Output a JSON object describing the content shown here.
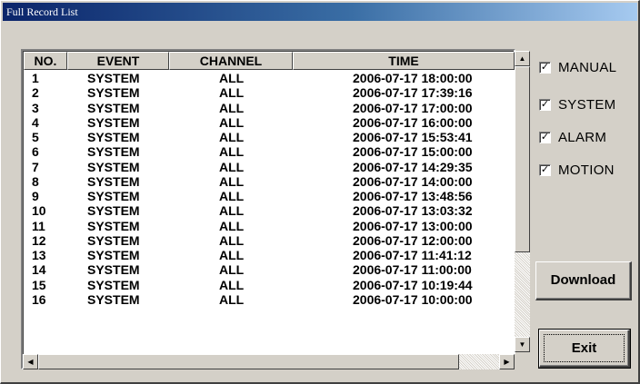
{
  "window": {
    "title": "Full Record List"
  },
  "table": {
    "columns": [
      "NO.",
      "EVENT",
      "CHANNEL",
      "TIME"
    ],
    "rows": [
      {
        "no": "1",
        "event": "SYSTEM",
        "channel": "ALL",
        "time": "2006-07-17  18:00:00"
      },
      {
        "no": "2",
        "event": "SYSTEM",
        "channel": "ALL",
        "time": "2006-07-17  17:39:16"
      },
      {
        "no": "3",
        "event": "SYSTEM",
        "channel": "ALL",
        "time": "2006-07-17  17:00:00"
      },
      {
        "no": "4",
        "event": "SYSTEM",
        "channel": "ALL",
        "time": "2006-07-17  16:00:00"
      },
      {
        "no": "5",
        "event": "SYSTEM",
        "channel": "ALL",
        "time": "2006-07-17  15:53:41"
      },
      {
        "no": "6",
        "event": "SYSTEM",
        "channel": "ALL",
        "time": "2006-07-17  15:00:00"
      },
      {
        "no": "7",
        "event": "SYSTEM",
        "channel": "ALL",
        "time": "2006-07-17  14:29:35"
      },
      {
        "no": "8",
        "event": "SYSTEM",
        "channel": "ALL",
        "time": "2006-07-17  14:00:00"
      },
      {
        "no": "9",
        "event": "SYSTEM",
        "channel": "ALL",
        "time": "2006-07-17  13:48:56"
      },
      {
        "no": "10",
        "event": "SYSTEM",
        "channel": "ALL",
        "time": "2006-07-17  13:03:32"
      },
      {
        "no": "11",
        "event": "SYSTEM",
        "channel": "ALL",
        "time": "2006-07-17  13:00:00"
      },
      {
        "no": "12",
        "event": "SYSTEM",
        "channel": "ALL",
        "time": "2006-07-17  12:00:00"
      },
      {
        "no": "13",
        "event": "SYSTEM",
        "channel": "ALL",
        "time": "2006-07-17  11:41:12"
      },
      {
        "no": "14",
        "event": "SYSTEM",
        "channel": "ALL",
        "time": "2006-07-17  11:00:00"
      },
      {
        "no": "15",
        "event": "SYSTEM",
        "channel": "ALL",
        "time": "2006-07-17  10:19:44"
      },
      {
        "no": "16",
        "event": "SYSTEM",
        "channel": "ALL",
        "time": "2006-07-17  10:00:00"
      }
    ]
  },
  "filters": [
    {
      "label": "MANUAL",
      "checked": true
    },
    {
      "label": "SYSTEM",
      "checked": true
    },
    {
      "label": "ALARM",
      "checked": true
    },
    {
      "label": "MOTION",
      "checked": true
    }
  ],
  "buttons": {
    "download": "Download",
    "exit": "Exit"
  },
  "icons": {
    "scroll_up": "▲",
    "scroll_down": "▼",
    "scroll_left": "◀",
    "scroll_right": "▶",
    "check": "✓"
  }
}
